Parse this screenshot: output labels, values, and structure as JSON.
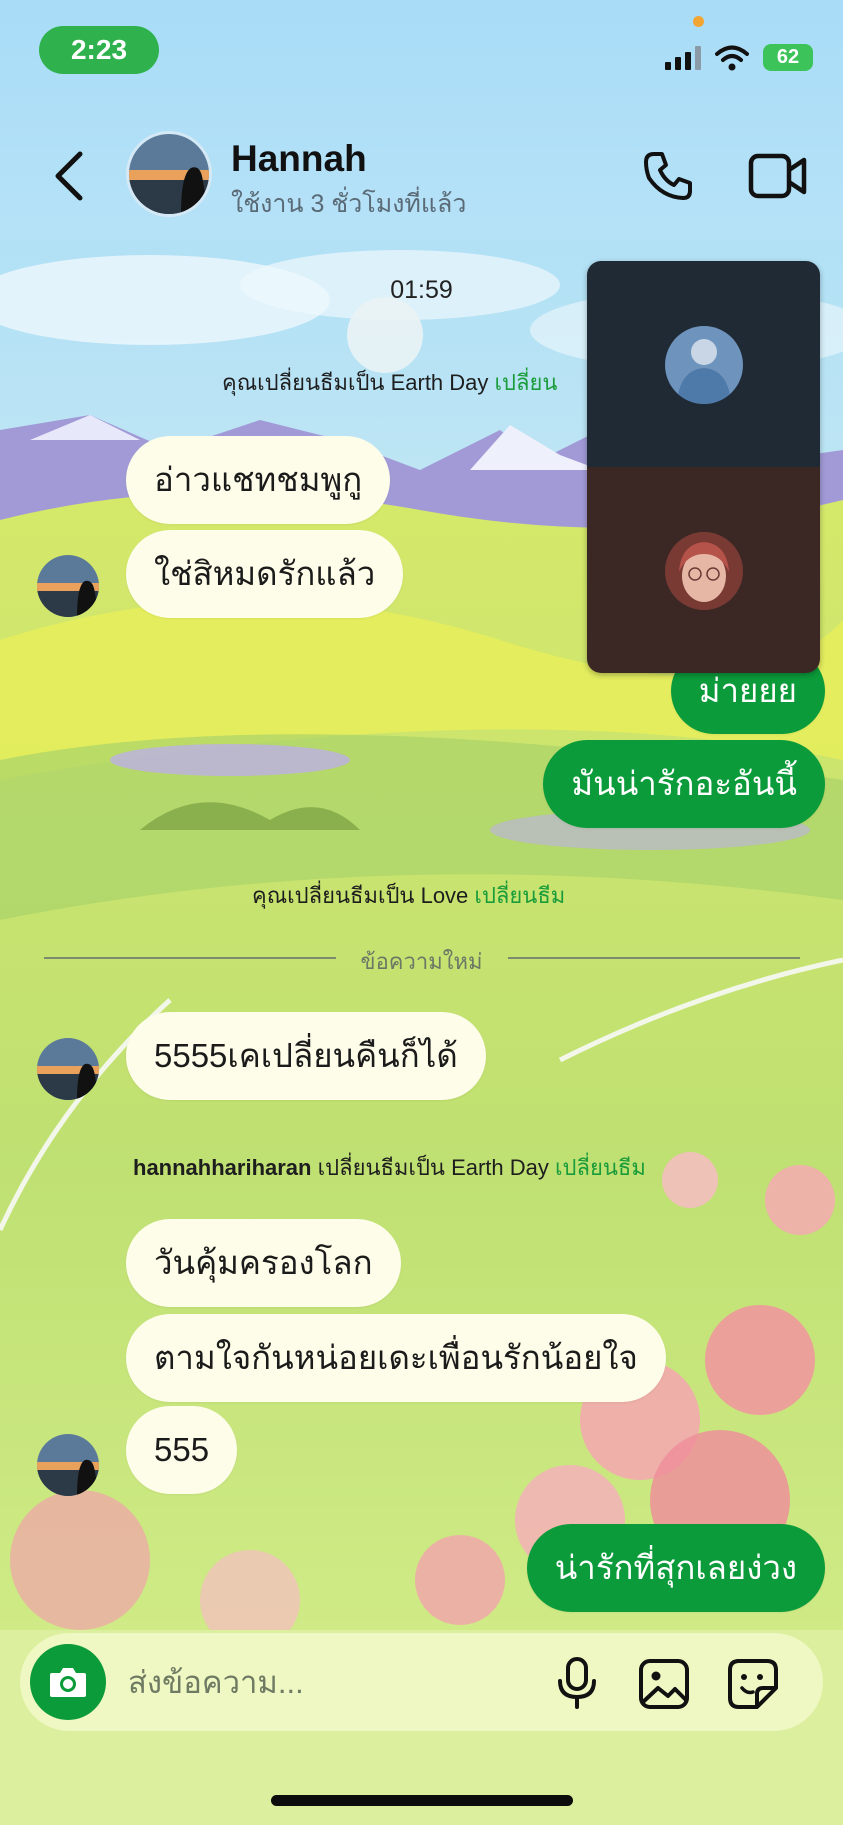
{
  "status_bar": {
    "time": "2:23",
    "battery": "62"
  },
  "header": {
    "contact_name": "Hannah",
    "presence": "ใช้งาน 3 ชั่วโมงที่แล้ว"
  },
  "chat": {
    "timestamp": "01:59",
    "system1": {
      "text": "คุณเปลี่ยนธีมเป็น Earth Day",
      "action": "เปลี่ยน"
    },
    "in1": "อ่าวแชทชมพูกู",
    "in2": "ใช่สิหมดรักแล้ว",
    "out1": "ม่ายยย",
    "out2": "มันน่ารักอะอันนี้",
    "system2": {
      "text": "คุณเปลี่ยนธีมเป็น Love",
      "action": "เปลี่ยนธีม"
    },
    "new_messages": "ข้อความใหม่",
    "in3": "5555เคเปลี่ยนคืนก็ได้",
    "system3": {
      "user": "hannahhariharan",
      "text": "เปลี่ยนธีมเป็น Earth Day",
      "action": "เปลี่ยนธีม"
    },
    "in4": "วันคุ้มครองโลก",
    "in5": "ตามใจกันหน่อยเดะเพื่อนรักน้อยใจ",
    "in6": "555",
    "out3": "น่ารักที่สุกเลยง่วง"
  },
  "composer": {
    "placeholder": "ส่งข้อความ..."
  },
  "colors": {
    "accent": "#0b9b3a",
    "incoming_bubble": "#fdfde9",
    "header_bg": "#a8dcf7"
  }
}
